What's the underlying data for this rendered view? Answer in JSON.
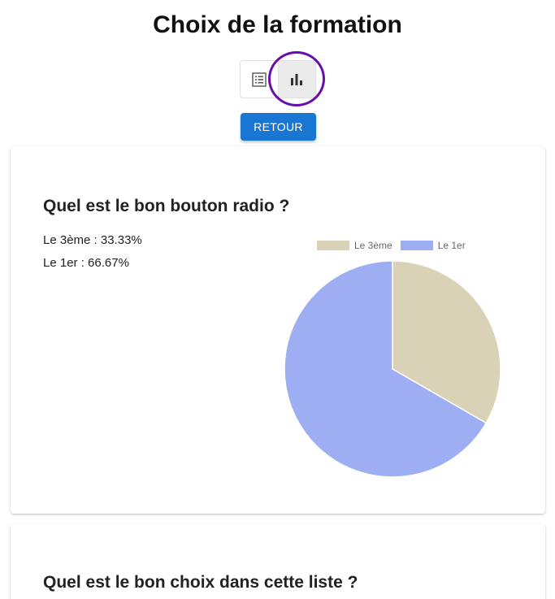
{
  "page": {
    "title": "Choix de la formation"
  },
  "view_toggle": {
    "list_icon": "list-icon",
    "chart_icon": "bar-chart-icon",
    "active": "chart"
  },
  "retour_label": "RETOUR",
  "questions": [
    {
      "title": "Quel est le bon bouton radio ?",
      "results": [
        "Le 3ème : 33.33%",
        "Le 1er : 66.67%"
      ]
    },
    {
      "title": "Quel est le bon choix dans cette liste ?"
    }
  ],
  "chart_data": {
    "type": "pie",
    "labels": [
      "Le 3ème",
      "Le 1er"
    ],
    "values": [
      33.33,
      66.67
    ],
    "colors": [
      "#d9d2b7",
      "#9daef3"
    ],
    "legend_position": "top"
  }
}
